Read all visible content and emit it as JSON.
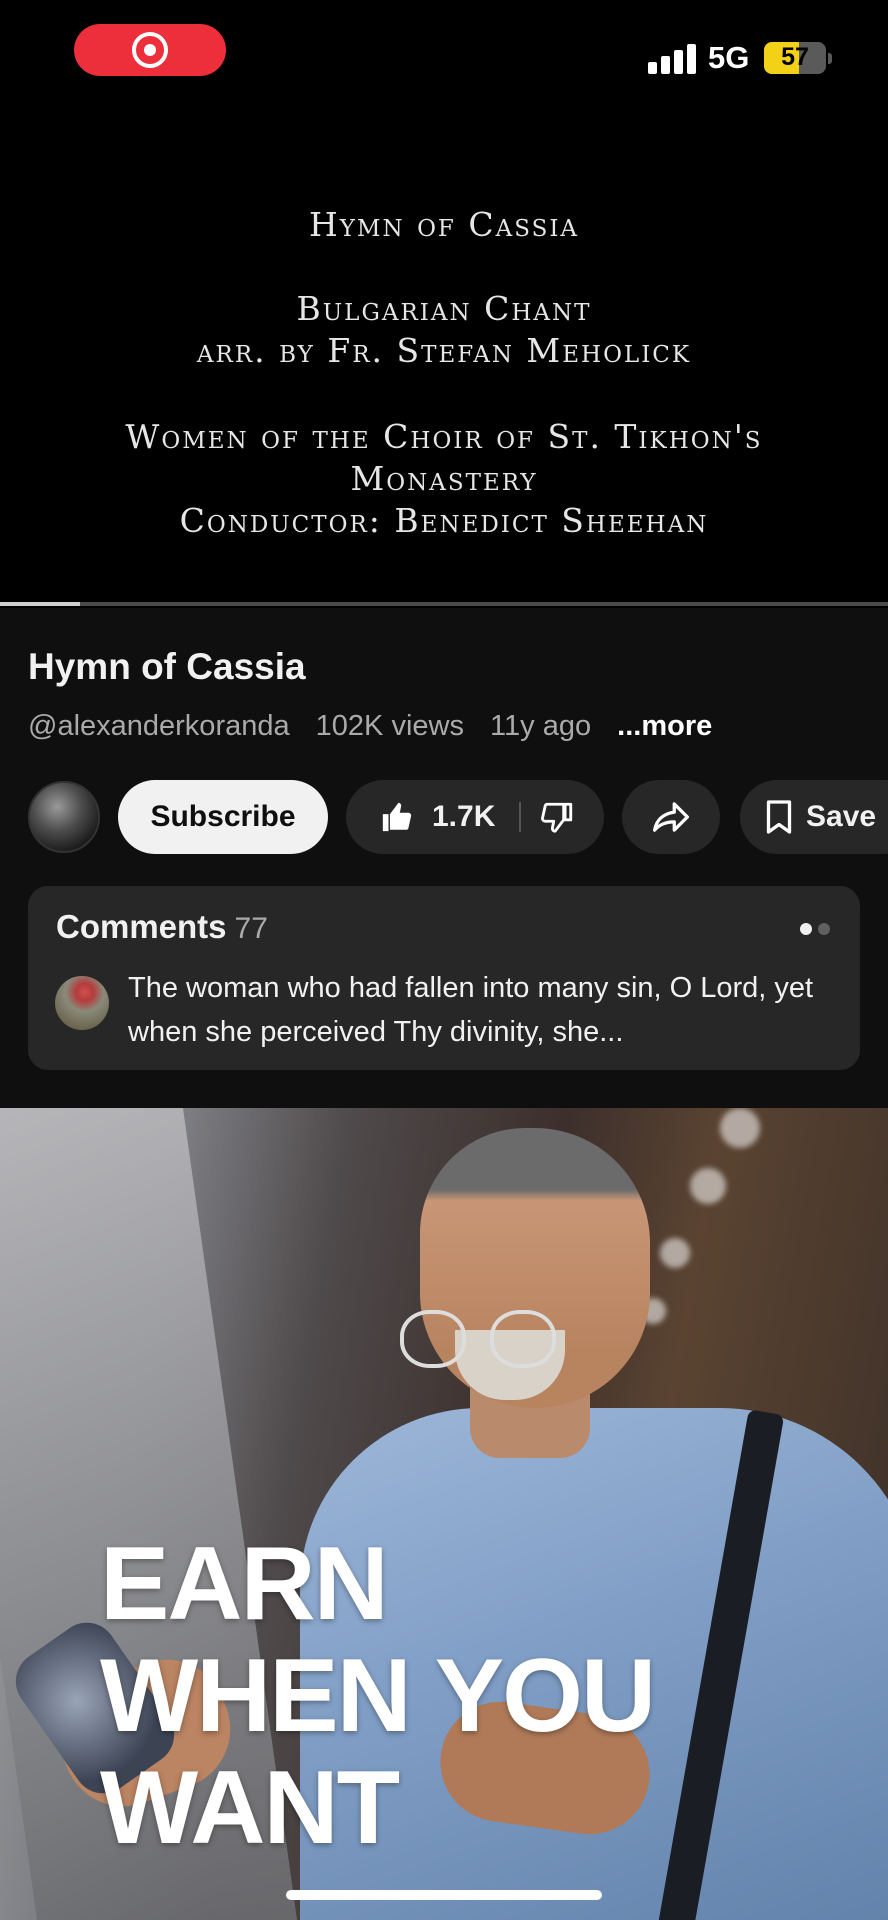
{
  "status_bar": {
    "network": "5G",
    "battery_level": "57",
    "battery_fraction": 0.57,
    "signal_bars": 4,
    "recording": true
  },
  "video": {
    "overlay_lines": [
      "Hymn of Cassia",
      "Bulgarian Chant",
      "arr. by Fr. Stefan Meholick",
      "Women of the Choir of St. Tikhon's",
      "Monastery",
      "Conductor: Benedict Sheehan"
    ],
    "progress_fraction": 0.09
  },
  "metadata": {
    "title": "Hymn of Cassia",
    "channel": "@alexanderkoranda",
    "views": "102K views",
    "age": "11y ago",
    "more_label": "...more"
  },
  "actions": {
    "subscribe_label": "Subscribe",
    "like_count": "1.7K",
    "save_label": "Save"
  },
  "comments": {
    "heading": "Comments",
    "count": "77",
    "preview_text": "The woman who had fallen into many sin, O Lord, yet when she perceived Thy divinity, she...",
    "page_dots": 2,
    "active_dot": 0
  },
  "ad": {
    "headline_lines": [
      "EARN",
      "WHEN YOU",
      "WANT"
    ]
  },
  "colors": {
    "background": "#0f0f0f",
    "record_red": "#ec2f3b",
    "battery_yellow": "#f2d116",
    "pill_bg": "#272727",
    "subscribe_bg": "#f1f1f1",
    "secondary_text": "#aaaaaa"
  },
  "icons": {
    "like": "thumbs-up-icon",
    "dislike": "thumbs-down-icon",
    "share": "share-arrow-icon",
    "save": "bookmark-icon",
    "record": "record-icon"
  }
}
